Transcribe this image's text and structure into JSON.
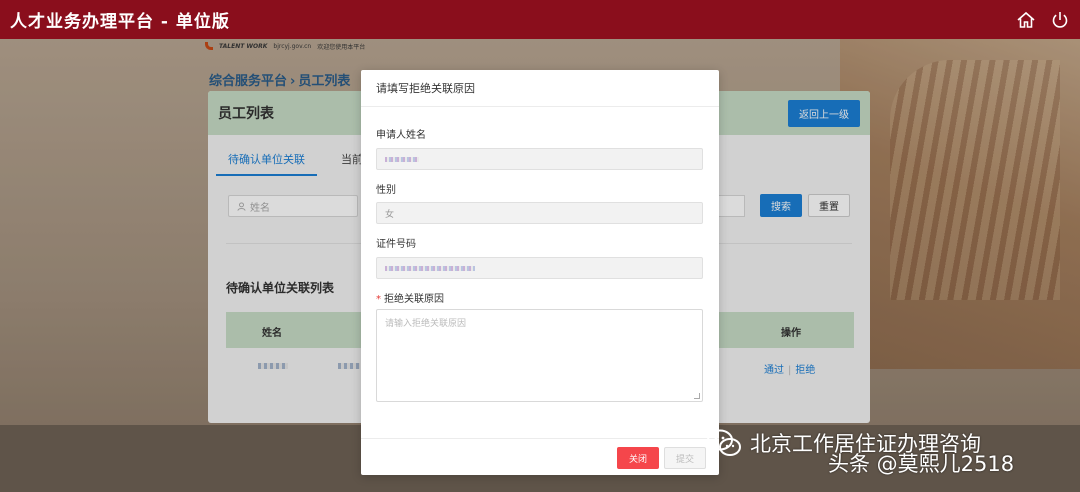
{
  "header": {
    "title": "人才业务办理平台 - 单位版",
    "icons": [
      "home-icon",
      "power-icon"
    ]
  },
  "logo": {
    "brand": "TALENT WORK",
    "url": "bjrcyj.gov.cn",
    "slogan": "欢迎您使用本平台"
  },
  "breadcrumb": {
    "root": "综合服务平台",
    "sep": "›",
    "current": "员工列表"
  },
  "panel": {
    "title": "员工列表",
    "back_label": "返回上一级",
    "tabs": [
      {
        "label": "待确认单位关联",
        "active": true
      },
      {
        "label": "当前"
      }
    ],
    "search_placeholder": "姓名",
    "search_label": "搜索",
    "reset_label": "重置",
    "list_title": "待确认单位关联列表",
    "columns": {
      "name": "姓名",
      "op": "操作"
    },
    "row_actions": {
      "approve": "通过",
      "sep": "|",
      "reject": "拒绝"
    }
  },
  "modal": {
    "title": "请填写拒绝关联原因",
    "applicant_label": "申请人姓名",
    "gender_label": "性别",
    "gender_value": "女",
    "id_label": "证件号码",
    "reason_required": "*",
    "reason_label": "拒绝关联原因",
    "reason_placeholder": "请输入拒绝关联原因",
    "close_label": "关闭",
    "submit_label": "提交"
  },
  "watermark": {
    "line1": "北京工作居住证办理咨询",
    "line2": "头条 @莫熙儿2518"
  },
  "colors": {
    "topbar": "#8a0e1c",
    "primary": "#1b7fd6",
    "danger": "#f5464b",
    "table_header": "#c8dcc6"
  }
}
